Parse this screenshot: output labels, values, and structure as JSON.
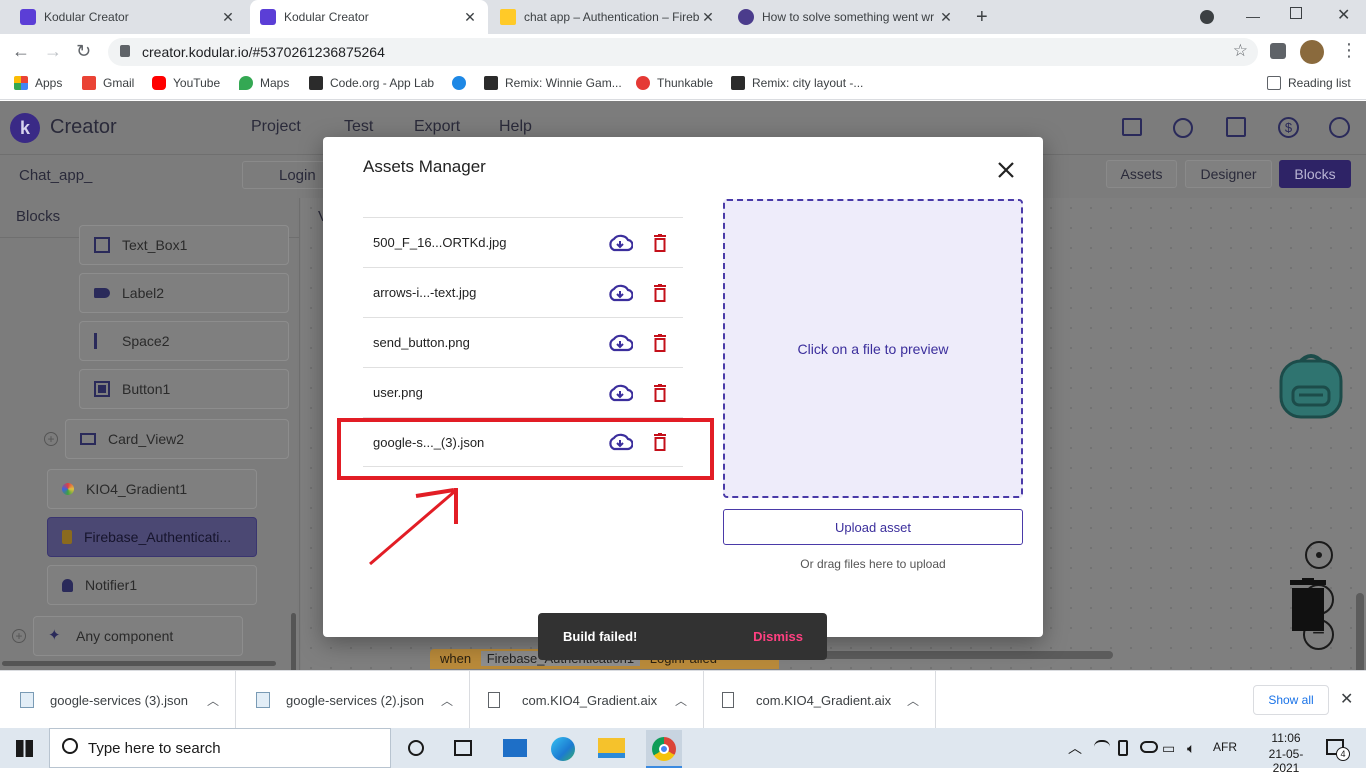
{
  "browser": {
    "tabs": [
      {
        "title": "Kodular Creator",
        "active": false,
        "favicon": "kodular-icon"
      },
      {
        "title": "Kodular Creator",
        "active": true,
        "favicon": "kodular-icon"
      },
      {
        "title": "chat app – Authentication – Fireb",
        "active": false,
        "favicon": "firebase-icon"
      },
      {
        "title": "How to solve something went wr",
        "active": false,
        "favicon": "kodular-icon"
      }
    ],
    "url": "creator.kodular.io/#5370261236875264",
    "bookmarks": [
      {
        "label": "Apps",
        "icon": "apps-grid-icon"
      },
      {
        "label": "Gmail",
        "icon": "gmail-icon"
      },
      {
        "label": "YouTube",
        "icon": "youtube-icon"
      },
      {
        "label": "Maps",
        "icon": "maps-icon"
      },
      {
        "label": "Code.org - App Lab",
        "icon": "codeorg-icon"
      },
      {
        "label": "",
        "icon": "firefox-icon"
      },
      {
        "label": "Remix: Winnie Gam...",
        "icon": "codeorg-icon"
      },
      {
        "label": "Thunkable",
        "icon": "thunkable-icon"
      },
      {
        "label": "Remix: city layout -...",
        "icon": "codeorg-icon"
      }
    ],
    "reading_list": "Reading list"
  },
  "app": {
    "brand": "Creator",
    "menu": [
      "Project",
      "Test",
      "Export",
      "Help"
    ],
    "project_name": "Chat_app_",
    "screen": "Login",
    "views": [
      "Assets",
      "Designer",
      "Blocks"
    ],
    "active_view": "Blocks",
    "blocks_title": "Blocks",
    "workspace_tab_letter": "V",
    "components": [
      "Text_Box1",
      "Label2",
      "Space2",
      "Button1",
      "Card_View2",
      "KIO4_Gradient1",
      "Firebase_Authenticati...",
      "Notifier1",
      "Any component"
    ],
    "block_when": "when",
    "block_component": "Firebase_Authentication1",
    "block_event": "LoginFailed"
  },
  "modal": {
    "title": "Assets Manager",
    "assets": [
      "500_F_16...ORTKd.jpg",
      "arrows-i...-text.jpg",
      "send_button.png",
      "user.png",
      "google-s..._(3).json"
    ],
    "preview_text": "Click on a file to preview",
    "upload_label": "Upload asset",
    "drag_hint": "Or drag files here to upload"
  },
  "toast": {
    "message": "Build failed!",
    "action": "Dismiss"
  },
  "downloads": {
    "items": [
      "google-services (3).json",
      "google-services (2).json",
      "com.KIO4_Gradient.aix",
      "com.KIO4_Gradient.aix"
    ],
    "show_all": "Show all"
  },
  "taskbar": {
    "search_placeholder": "Type here to search",
    "language": "AFR",
    "time": "11:06",
    "date": "21-05-2021",
    "notifications": "4"
  },
  "colors": {
    "accent": "#4a3aa8",
    "delete": "#c4101a",
    "annotation": "#e21d25",
    "toast_action": "#ff4081"
  }
}
